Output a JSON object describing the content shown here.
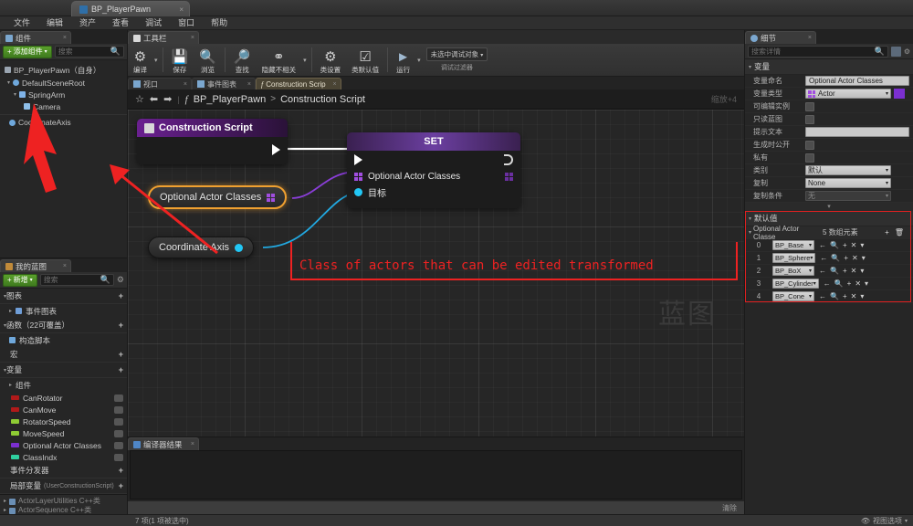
{
  "window": {
    "tab_title": "BP_PlayerPawn",
    "close_glyph": "×"
  },
  "menubar": {
    "items": [
      "文件",
      "编辑",
      "资产",
      "查看",
      "调试",
      "窗口",
      "帮助"
    ]
  },
  "components_panel": {
    "tab_label": "组件",
    "add_button": "添加组件",
    "search_placeholder": "搜索",
    "tree": [
      {
        "label": "BP_PlayerPawn（自身）",
        "indent": 0,
        "color": "#bdbdbd"
      },
      {
        "label": "DefaultSceneRoot",
        "indent": 1,
        "color": "#bdbdbd"
      },
      {
        "label": "SpringArm",
        "indent": 2,
        "color": "#bdbdbd"
      },
      {
        "label": "Camera",
        "indent": 3,
        "color": "#bdbdbd"
      },
      {
        "label": "CoordinateAxis",
        "indent": 1,
        "color": "#bdbdbd"
      }
    ]
  },
  "myblueprint_panel": {
    "tab_label": "我的蓝图",
    "add_button": "新增",
    "search_placeholder": "搜索",
    "sections": [
      {
        "label": "图表",
        "type": "section"
      },
      {
        "label": "事件图表",
        "type": "item"
      },
      {
        "label": "函数（22可覆盖）",
        "type": "section"
      },
      {
        "label": "构造脚本",
        "type": "item"
      },
      {
        "label": "宏",
        "type": "section"
      },
      {
        "label": "变量",
        "type": "section"
      },
      {
        "label": "组件",
        "type": "subsection"
      }
    ],
    "variables": [
      {
        "name": "CanRotator",
        "color": "#b01a1a"
      },
      {
        "name": "CanMove",
        "color": "#b01a1a"
      },
      {
        "name": "RotatorSpeed",
        "color": "#8ecb34"
      },
      {
        "name": "MoveSpeed",
        "color": "#8ecb34"
      },
      {
        "name": "Optional Actor Classes",
        "color": "#7b2fd0"
      },
      {
        "name": "ClassIndx",
        "color": "#2fd0a0"
      }
    ],
    "footer_sections": [
      {
        "label": "事件分发器"
      },
      {
        "label": "局部变量",
        "suffix": "(UserConstructionScript)"
      }
    ]
  },
  "content_browser_stub": {
    "rows": [
      "ActorLayerUtilities C++类",
      "ActorSequence C++类"
    ]
  },
  "toolbar": {
    "tab_label": "工具栏",
    "buttons": [
      {
        "label": "编译",
        "icon": "compile-icon"
      },
      {
        "label": "保存",
        "icon": "save-icon"
      },
      {
        "label": "浏览",
        "icon": "browse-icon"
      },
      {
        "label": "查找",
        "icon": "find-icon"
      },
      {
        "label": "隐藏不相关",
        "icon": "hide-unrelated-icon"
      },
      {
        "label": "类设置",
        "icon": "class-settings-icon"
      },
      {
        "label": "类默认值",
        "icon": "class-defaults-icon"
      },
      {
        "label": "运行",
        "icon": "play-icon"
      }
    ],
    "debug_selector": "未选中调试对象",
    "debug_filter_label": "调试过滤器"
  },
  "graph_tabs": [
    {
      "label": "视口",
      "active": false
    },
    {
      "label": "事件图表",
      "active": false
    },
    {
      "label": "Construction Scrip",
      "active": true
    }
  ],
  "breadcrumb": {
    "root": "BP_PlayerPawn",
    "separator": ">",
    "leaf": "Construction Script",
    "zoom_label": "缩放+4"
  },
  "graph": {
    "watermark": "蓝图",
    "annotation": "Class of actors that can be edited transformed",
    "nodes": [
      {
        "id": "construction-script",
        "title": "Construction Script",
        "type": "event"
      },
      {
        "id": "set-node",
        "title": "SET",
        "type": "set",
        "pins": [
          "Optional Actor Classes",
          "目标"
        ]
      },
      {
        "id": "var-optional-actor-classes",
        "title": "Optional Actor Classes",
        "type": "variable",
        "selected": true
      },
      {
        "id": "var-coordinate-axis",
        "title": "Coordinate Axis",
        "type": "variable",
        "selected": false
      }
    ]
  },
  "compiler_panel": {
    "tab_label": "编译器结果",
    "footer_label": "清除"
  },
  "details_panel": {
    "tab_label": "细节",
    "search_placeholder": "搜索详情",
    "variable_section": "变量",
    "properties": [
      {
        "label": "变量命名",
        "value": "Optional Actor Classes",
        "kind": "text"
      },
      {
        "label": "变量类型",
        "value": "Actor",
        "kind": "type"
      },
      {
        "label": "可编辑实例",
        "value": "",
        "kind": "check"
      },
      {
        "label": "只读蓝图",
        "value": "",
        "kind": "check"
      },
      {
        "label": "提示文本",
        "value": "",
        "kind": "text"
      },
      {
        "label": "生成时公开",
        "value": "",
        "kind": "check"
      },
      {
        "label": "私有",
        "value": "",
        "kind": "check"
      },
      {
        "label": "类别",
        "value": "默认",
        "kind": "combo"
      },
      {
        "label": "复制",
        "value": "None",
        "kind": "combo"
      },
      {
        "label": "复制条件",
        "value": "无",
        "kind": "combo-disabled"
      }
    ],
    "defaults_section": "默认值",
    "array": {
      "label": "Optional Actor Classe",
      "count_label": "5 数组元素",
      "elements": [
        {
          "index": "0",
          "value": "BP_Base"
        },
        {
          "index": "1",
          "value": "BP_Sphere"
        },
        {
          "index": "2",
          "value": "BP_BoX"
        },
        {
          "index": "3",
          "value": "BP_Cylinder"
        },
        {
          "index": "4",
          "value": "BP_Cone"
        }
      ]
    }
  },
  "statusbar": {
    "middle": "7 项(1 项被选中)",
    "right": "视图选项"
  },
  "colors": {
    "accent_purple": "#7b2fd0",
    "exec_white": "#ffffff",
    "object_blue": "#22c7f5",
    "annotation_red": "#ee2222",
    "selected_orange": "#f0a030"
  }
}
